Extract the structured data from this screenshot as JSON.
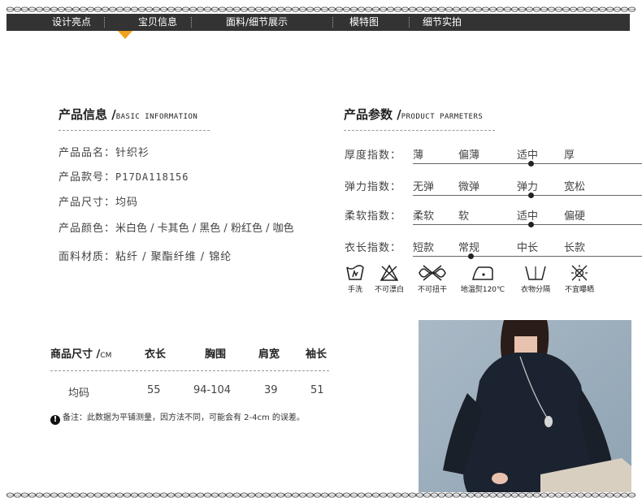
{
  "nav": {
    "tabs": [
      {
        "label": "设计亮点"
      },
      {
        "label": "宝贝信息"
      },
      {
        "label": "面料/细节展示"
      },
      {
        "label": "模特图"
      },
      {
        "label": "细节实拍"
      }
    ],
    "active_index": 1,
    "accent_color": "#f0a21b"
  },
  "basic_info": {
    "title_cn": "产品信息 /",
    "title_en": "BASIC INFORMATION",
    "rows": [
      {
        "label": "产品品名：",
        "value": "针织衫"
      },
      {
        "label": "产品款号：",
        "value": "P17DA118156"
      },
      {
        "label": "产品尺寸：",
        "value": "均码"
      },
      {
        "label": "产品颜色：",
        "value": "米白色 / 卡其色 / 黑色 / 粉红色 / 咖色"
      },
      {
        "label": "面料材质：",
        "value": "粘纤 / 聚酯纤维 / 锦纶"
      }
    ]
  },
  "params": {
    "title_cn": "产品参数 /",
    "title_en": "PRODUCT PARMETERS",
    "rows": [
      {
        "label": "厚度指数：",
        "options": [
          "薄",
          "偏薄",
          "适中",
          "厚"
        ],
        "selected_index": 2
      },
      {
        "label": "弹力指数：",
        "options": [
          "无弹",
          "微弹",
          "弹力",
          "宽松"
        ],
        "selected_index": 2
      },
      {
        "label": "柔软指数：",
        "options": [
          "柔软",
          "软",
          "适中",
          "偏硬"
        ],
        "selected_index": 2
      },
      {
        "label": "衣长指数：",
        "options": [
          "短款",
          "常规",
          "中长",
          "长款"
        ],
        "selected_index": 1
      }
    ]
  },
  "care": [
    {
      "label": "手洗",
      "icon": "hand-wash-icon"
    },
    {
      "label": "不可漂白",
      "icon": "no-bleach-icon"
    },
    {
      "label": "不可扭干",
      "icon": "no-wring-icon"
    },
    {
      "label": "地温熨120℃",
      "icon": "low-iron-icon"
    },
    {
      "label": "衣物分隔",
      "icon": "separate-wash-icon"
    },
    {
      "label": "不宜曝晒",
      "icon": "no-sun-icon"
    }
  ],
  "size_table": {
    "header": {
      "name": "商品尺寸 /",
      "unit": "CM"
    },
    "columns": [
      "衣长",
      "胸围",
      "肩宽",
      "袖长"
    ],
    "rows": [
      {
        "size": "均码",
        "values": [
          "55",
          "94-104",
          "39",
          "51"
        ]
      }
    ],
    "note": "备注：此数据为平铺测量，因方法不同，可能会有 2-4cm 的误差。"
  }
}
